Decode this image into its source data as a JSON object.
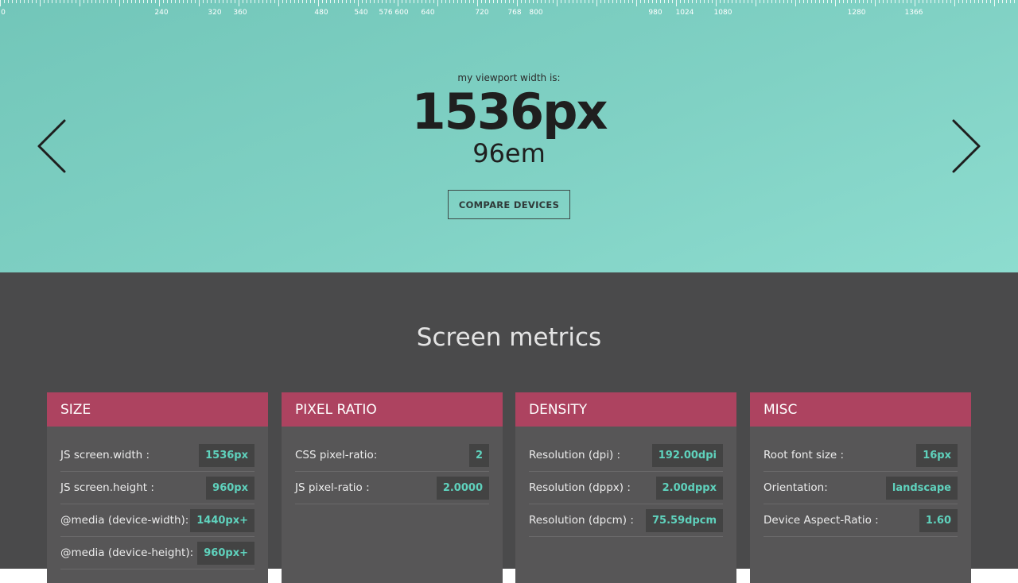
{
  "ruler": {
    "labels": [
      "0",
      "240",
      "320",
      "360",
      "480",
      "540",
      "576",
      "600",
      "640",
      "720",
      "768",
      "800",
      "980",
      "1024",
      "1080",
      "1280",
      "1366"
    ]
  },
  "hero": {
    "caption": "my viewport width is:",
    "width_px": "1536px",
    "width_em": "96em",
    "compare_label": "COMPARE DEVICES",
    "prev_icon": "chevron-left",
    "next_icon": "chevron-right"
  },
  "metrics": {
    "title": "Screen metrics",
    "cards": [
      {
        "title": "SIZE",
        "rows": [
          {
            "label": "JS screen.width :",
            "value": "1536px"
          },
          {
            "label": "JS screen.height :",
            "value": "960px"
          },
          {
            "label": "@media (device-width):",
            "value": "1440px+"
          },
          {
            "label": "@media (device-height):",
            "value": "960px+"
          }
        ]
      },
      {
        "title": "PIXEL RATIO",
        "rows": [
          {
            "label": "CSS pixel-ratio:",
            "value": "2"
          },
          {
            "label": "JS pixel-ratio :",
            "value": "2.0000"
          }
        ]
      },
      {
        "title": "DENSITY",
        "rows": [
          {
            "label": "Resolution (dpi) :",
            "value": "192.00dpi"
          },
          {
            "label": "Resolution (dppx) :",
            "value": "2.00dppx"
          },
          {
            "label": "Resolution (dpcm) :",
            "value": "75.59dpcm"
          }
        ]
      },
      {
        "title": "MISC",
        "rows": [
          {
            "label": "Root font size :",
            "value": "16px"
          },
          {
            "label": "Orientation:",
            "value": "landscape"
          },
          {
            "label": "Device Aspect-Ratio :",
            "value": "1.60"
          }
        ]
      }
    ]
  },
  "colors": {
    "hero_bg": "#7fcfc2",
    "card_header": "#ad4360",
    "value_text": "#5fd2bd",
    "dark_bg": "#4a4a4b"
  }
}
